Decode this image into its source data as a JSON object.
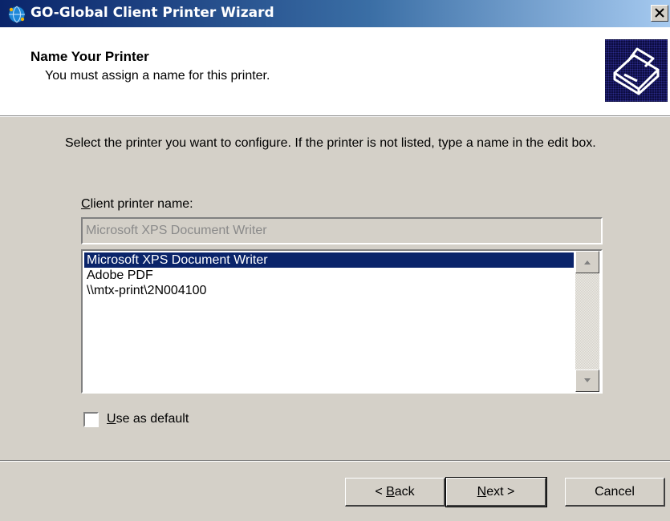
{
  "window": {
    "title": "GO-Global Client Printer Wizard",
    "icon": "globe-icon",
    "close_icon": "close-icon"
  },
  "header": {
    "title": "Name Your Printer",
    "subtitle": "You must assign a name for this printer.",
    "graphic_icon": "printer-icon"
  },
  "main": {
    "instructions": "Select the printer you want to configure.  If the printer is not listed, type a name in the edit box.",
    "client_printer_label": {
      "mnemonic": "C",
      "rest": "lient printer name:"
    },
    "client_printer_value": "Microsoft XPS Document Writer",
    "printer_list": [
      {
        "label": "Microsoft XPS Document Writer",
        "selected": true
      },
      {
        "label": "Adobe PDF",
        "selected": false
      },
      {
        "label": "\\\\mtx-print\\2N004100",
        "selected": false
      }
    ],
    "use_as_default": {
      "mnemonic": "U",
      "rest": "se as default",
      "checked": false
    }
  },
  "footer": {
    "back": {
      "prefix": "< ",
      "mnemonic": "B",
      "rest": "ack"
    },
    "next": {
      "mnemonic": "N",
      "rest": "ext >"
    },
    "cancel": "Cancel"
  },
  "colors": {
    "title_bar_start": "#0a246a",
    "title_bar_end": "#a6caf0",
    "selection": "#0a246a",
    "dialog_face": "#d4d0c8"
  }
}
